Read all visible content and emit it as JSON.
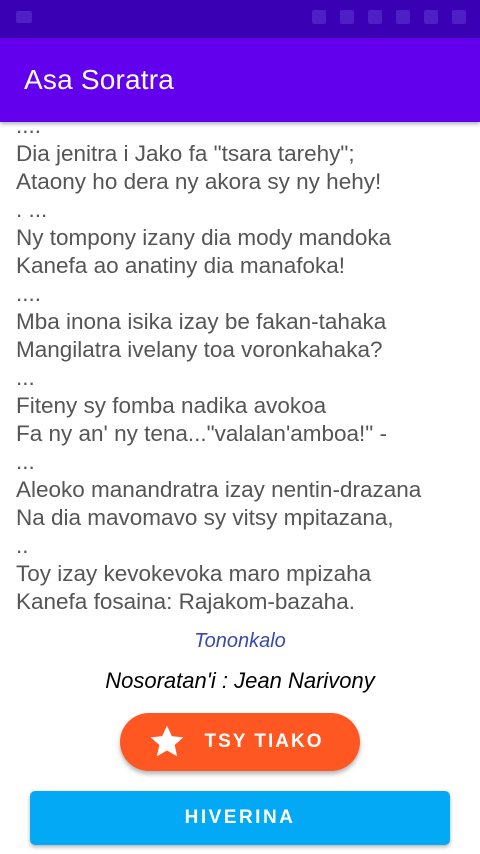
{
  "app": {
    "title": "Asa Soratra"
  },
  "poem_lines": [
    "....",
    "Dia jenitra i Jako fa \"tsara tarehy\";",
    "Ataony ho dera ny akora sy ny hehy!",
    ". ...",
    "Ny tompony izany dia mody mandoka",
    "Kanefa ao anatiny dia manafoka!",
    "....",
    "Mba inona isika izay be fakan-tahaka",
    "Mangilatra ivelany toa voronkahaka?",
    "...",
    "Fiteny sy fomba nadika avokoa",
    "Fa ny an' ny tena...\"valalan'amboa!\" -",
    "...",
    "Aleoko manandratra izay nentin-drazana",
    "Na dia mavomavo sy vitsy mpitazana,",
    "..",
    "Toy izay kevokevoka maro mpizaha",
    "Kanefa fosaina: Rajakom-bazaha."
  ],
  "genre": "Tononkalo",
  "author": "Nosoratan'i : Jean Narivony",
  "buttons": {
    "favorite_label": "TSY TIAKO",
    "back_label": "HIVERINA"
  },
  "colors": {
    "status_bar": "#3a00b3",
    "app_bar": "#6200ee",
    "favorite_button": "#ff5722",
    "back_button": "#03a9f4",
    "genre_text": "#3949ab"
  },
  "icons": {
    "favorite": "star-icon"
  }
}
